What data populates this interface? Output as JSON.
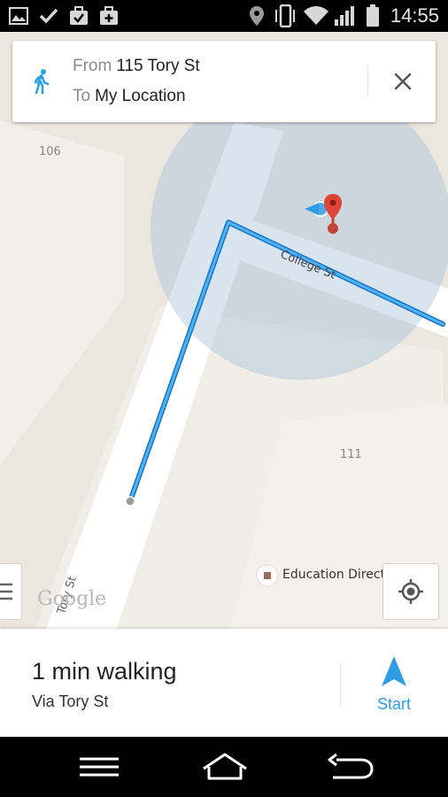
{
  "status_bar": {
    "time": "14:55",
    "left_icons": [
      "image-icon",
      "check-icon",
      "briefcase-check-icon",
      "briefcase-plus-icon"
    ],
    "right_icons": [
      "location-pin-icon",
      "vibrate-icon",
      "wifi-icon",
      "signal-icon",
      "battery-icon"
    ]
  },
  "directions_card": {
    "mode_icon": "walking-icon",
    "from_label": "From",
    "from_value": "115 Tory St",
    "to_label": "To",
    "to_value": "My Location"
  },
  "map": {
    "street_college": "College St",
    "street_tory": "Tory St",
    "building_106": "106",
    "building_111": "111",
    "poi_name": "Education Directions",
    "watermark": "Google"
  },
  "route_summary": {
    "duration": "1 min walking",
    "via": "Via Tory St",
    "start_label": "Start"
  },
  "colors": {
    "route": "#2f9de3",
    "accuracy_circle": "#b9cfe0",
    "accent": "#2f9de3",
    "marker_red": "#e0453a"
  }
}
